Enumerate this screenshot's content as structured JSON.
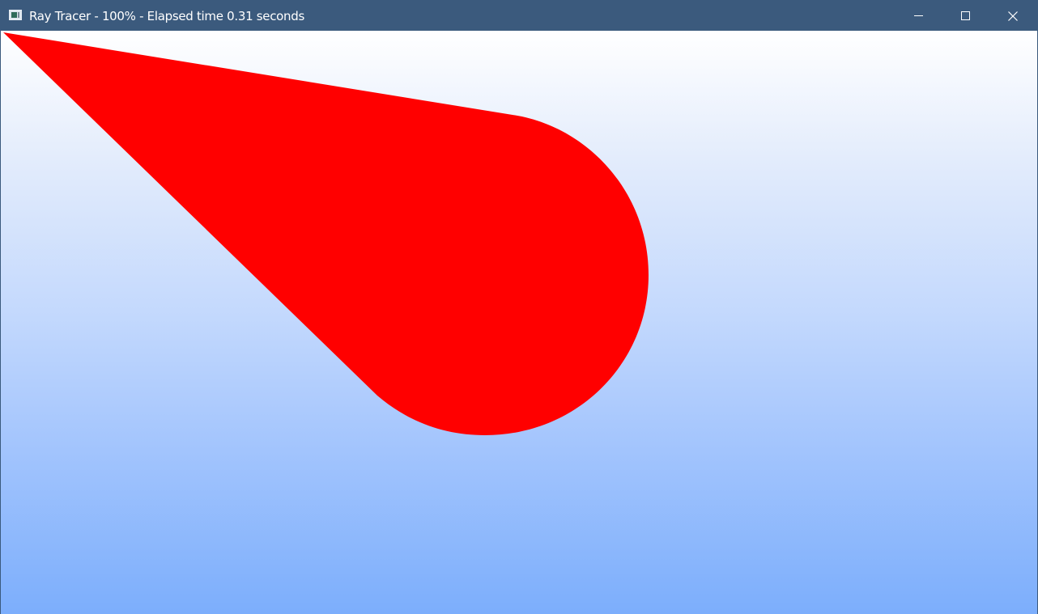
{
  "window": {
    "title": "Ray Tracer - 100% - Elapsed time 0.31 seconds",
    "titlebar_color": "#3b5a7d",
    "icon": "app-window-icon"
  },
  "controls": {
    "minimize_icon": "minimize-icon",
    "maximize_icon": "maximize-icon",
    "close_icon": "close-icon"
  },
  "render": {
    "sky_top_color": "#ffffff",
    "sky_bottom_color": "#7caefc",
    "shape_color": "#ff0000"
  }
}
